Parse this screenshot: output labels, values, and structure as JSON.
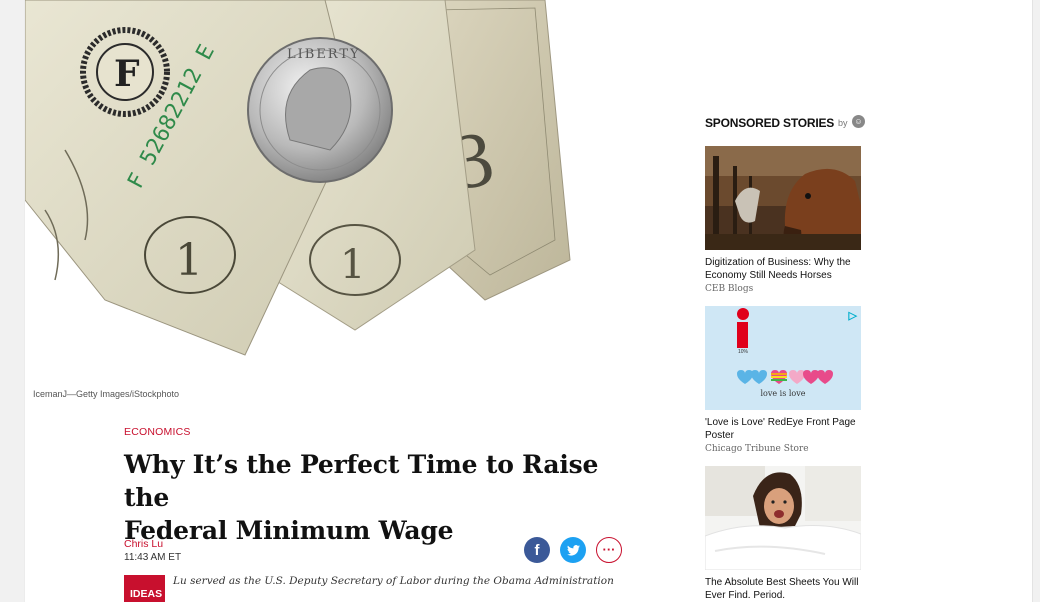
{
  "hero": {
    "credit": "IcemanJ—Getty Images/iStockphoto",
    "bill_serial": "F 52682212 E",
    "bill_seal_letter": "F",
    "coin_text": "LIBERTY",
    "bill_denomination": "1"
  },
  "article": {
    "section": "ECONOMICS",
    "headline_line1": "Why It’s the Perfect Time to Raise the",
    "headline_line2": "Federal Minimum Wage",
    "author": "Chris Lu",
    "time": "11:43 AM ET",
    "badge": "IDEAS",
    "contributor_note": "Lu served as the U.S. Deputy Secretary of Labor during the Obama Administration"
  },
  "share": {
    "facebook_glyph": "f",
    "twitter_glyph": "🐦",
    "more_glyph": "···"
  },
  "sponsored": {
    "heading": "SPONSORED STORIES",
    "by": "by",
    "stories": [
      {
        "title": "Digitization of Business: Why the Economy Still Needs Horses",
        "source": "CEB Blogs",
        "thumb_icon": "horse-photo"
      },
      {
        "title": "'Love is Love' RedEye Front Page Poster",
        "source": "Chicago Tribune Store",
        "thumb_icon": "love-is-love-poster",
        "thumb_caption": "love is love"
      },
      {
        "title": "The Absolute Best Sheets You Will Ever Find. Period.",
        "source": "",
        "thumb_icon": "woman-in-bed-photo"
      }
    ]
  },
  "colors": {
    "accent": "#c8102e",
    "facebook": "#3b5998",
    "twitter": "#1da1f2"
  }
}
